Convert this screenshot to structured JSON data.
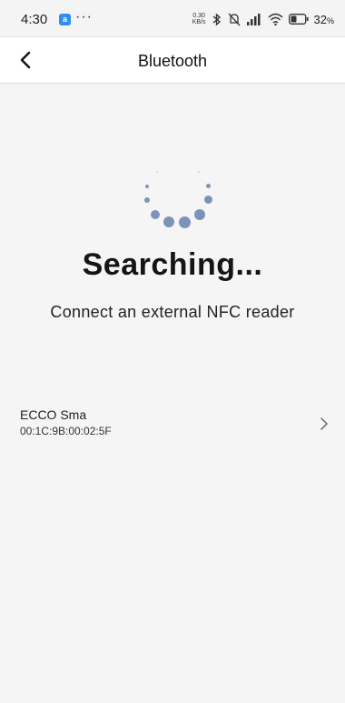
{
  "status_bar": {
    "time": "4:30",
    "app_badge": "a",
    "overflow": "···",
    "speed_value": "0.30",
    "speed_unit": "KB/s",
    "battery": "32",
    "battery_unit": "%",
    "icons": [
      "bluetooth-icon",
      "mute-icon",
      "signal-icon",
      "wifi-icon",
      "battery-icon"
    ]
  },
  "nav": {
    "title": "Bluetooth",
    "back_icon": "chevron-left-icon"
  },
  "search": {
    "title": "Searching...",
    "subtitle": "Connect an external NFC reader",
    "spinner_color": "#7c93b9"
  },
  "devices": [
    {
      "name": "ECCO Sma",
      "address": "00:1C:9B:00:02:5F",
      "icon": "chevron-right-icon"
    }
  ]
}
